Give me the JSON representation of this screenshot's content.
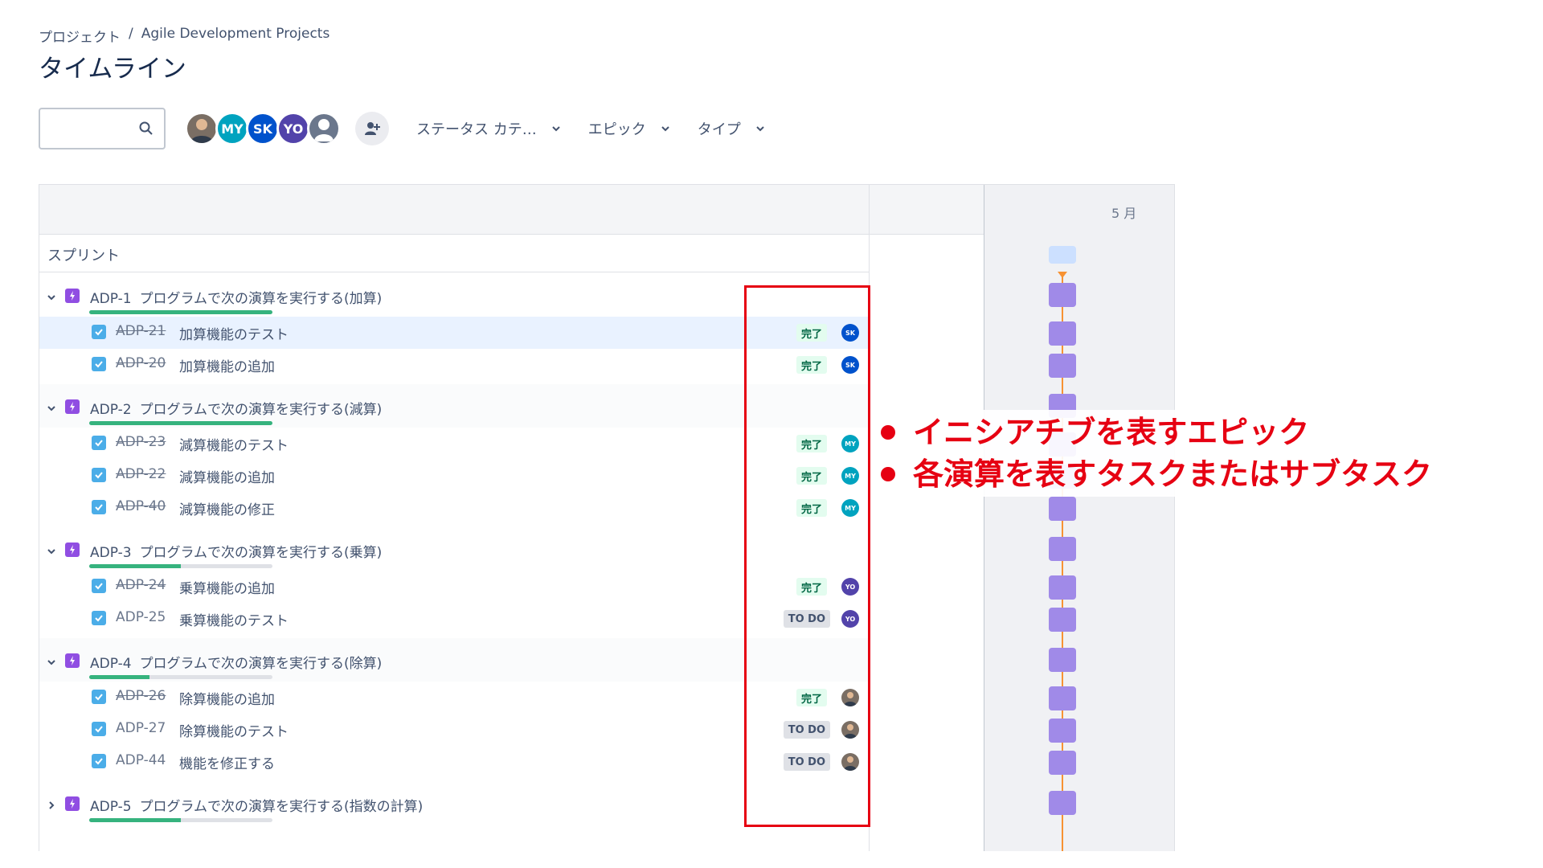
{
  "breadcrumb": {
    "root": "プロジェクト",
    "separator": "/",
    "project": "Agile Development Projects"
  },
  "page_title": "タイムライン",
  "toolbar": {
    "avatars": [
      {
        "initials": "",
        "color": "#7a6e64",
        "photo": true
      },
      {
        "initials": "MY",
        "color": "#00a3bf"
      },
      {
        "initials": "SK",
        "color": "#0052cc"
      },
      {
        "initials": "YO",
        "color": "#5243aa"
      },
      {
        "initials": "",
        "color": "#6b778c",
        "placeholder": true
      }
    ],
    "filters": {
      "status": "ステータス カテ…",
      "epic": "エピック",
      "type": "タイプ"
    }
  },
  "timeline": {
    "month": "5 月",
    "sprint_label": "スプリント"
  },
  "epics": [
    {
      "key": "ADP-1",
      "title": "プログラムで次の演算を実行する(加算)",
      "progress": 1.0,
      "tasks": [
        {
          "key": "ADP-21",
          "title": "加算機能のテスト",
          "status": "完了",
          "done": true,
          "assignee": "SK",
          "color": "#0052cc"
        },
        {
          "key": "ADP-20",
          "title": "加算機能の追加",
          "status": "完了",
          "done": true,
          "assignee": "SK",
          "color": "#0052cc"
        }
      ]
    },
    {
      "key": "ADP-2",
      "title": "プログラムで次の演算を実行する(減算)",
      "progress": 1.0,
      "tasks": [
        {
          "key": "ADP-23",
          "title": "減算機能のテスト",
          "status": "完了",
          "done": true,
          "assignee": "MY",
          "color": "#00a3bf"
        },
        {
          "key": "ADP-22",
          "title": "減算機能の追加",
          "status": "完了",
          "done": true,
          "assignee": "MY",
          "color": "#00a3bf"
        },
        {
          "key": "ADP-40",
          "title": "減算機能の修正",
          "status": "完了",
          "done": true,
          "assignee": "MY",
          "color": "#00a3bf"
        }
      ]
    },
    {
      "key": "ADP-3",
      "title": "プログラムで次の演算を実行する(乗算)",
      "progress": 0.5,
      "tasks": [
        {
          "key": "ADP-24",
          "title": "乗算機能の追加",
          "status": "完了",
          "done": true,
          "assignee": "YO",
          "color": "#5243aa"
        },
        {
          "key": "ADP-25",
          "title": "乗算機能のテスト",
          "status": "TO DO",
          "done": false,
          "assignee": "YO",
          "color": "#5243aa"
        }
      ]
    },
    {
      "key": "ADP-4",
      "title": "プログラムで次の演算を実行する(除算)",
      "progress": 0.33,
      "tasks": [
        {
          "key": "ADP-26",
          "title": "除算機能の追加",
          "status": "完了",
          "done": true,
          "assignee": "",
          "color": "#7a6e64"
        },
        {
          "key": "ADP-27",
          "title": "除算機能のテスト",
          "status": "TO DO",
          "done": false,
          "assignee": "",
          "color": "#7a6e64"
        },
        {
          "key": "ADP-44",
          "title": "機能を修正する",
          "status": "TO DO",
          "done": false,
          "assignee": "",
          "color": "#7a6e64"
        }
      ]
    },
    {
      "key": "ADP-5",
      "title": "プログラムで次の演算を実行する(指数の計算)",
      "progress": 0.5,
      "tasks": []
    }
  ],
  "annotation": {
    "line1": "イニシアチブを表すエピック",
    "line2": "各演算を表すタスクまたはサブタスク",
    "color": "#e60012"
  }
}
